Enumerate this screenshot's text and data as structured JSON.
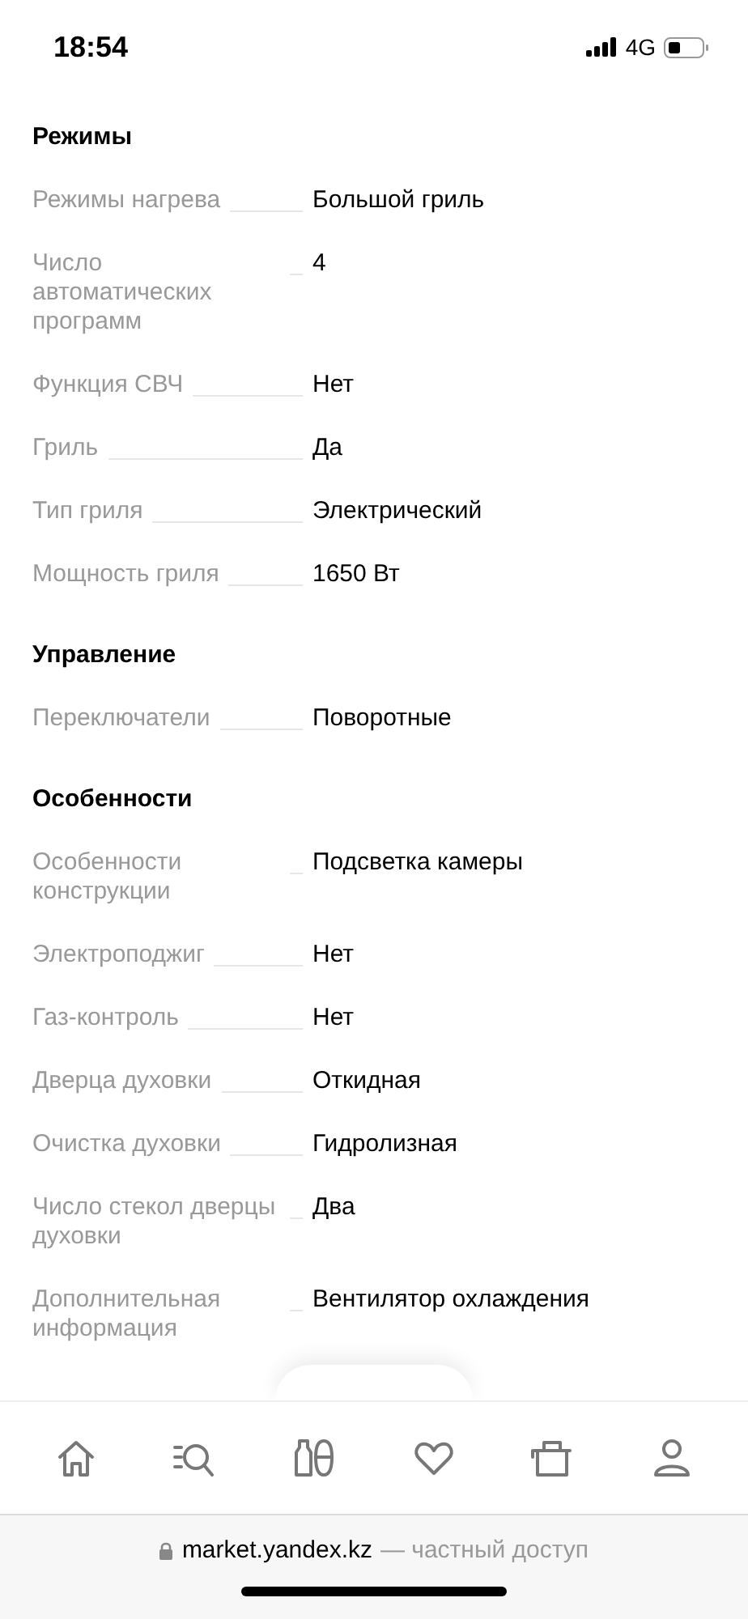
{
  "status_bar": {
    "time": "18:54",
    "network": "4G"
  },
  "sections": [
    {
      "title": "Режимы",
      "rows": [
        {
          "label": "Режимы нагрева",
          "value": "Большой гриль"
        },
        {
          "label": "Число автоматических программ",
          "value": "4"
        },
        {
          "label": "Функция СВЧ",
          "value": "Нет"
        },
        {
          "label": "Гриль",
          "value": "Да"
        },
        {
          "label": "Тип гриля",
          "value": "Электрический"
        },
        {
          "label": "Мощность гриля",
          "value": "1650 Вт"
        }
      ]
    },
    {
      "title": "Управление",
      "rows": [
        {
          "label": "Переключатели",
          "value": "Поворотные"
        }
      ]
    },
    {
      "title": "Особенности",
      "rows": [
        {
          "label": "Особенности конструкции",
          "value": "Подсветка камеры"
        },
        {
          "label": "Электроподжиг",
          "value": "Нет"
        },
        {
          "label": "Газ-контроль",
          "value": "Нет"
        },
        {
          "label": "Дверца духовки",
          "value": "Откидная"
        },
        {
          "label": "Очистка духовки",
          "value": "Гидролизная"
        },
        {
          "label": "Число стекол дверцы духовки",
          "value": "Два"
        },
        {
          "label": "Дополнительная информация",
          "value": "Вентилятор охлаждения"
        }
      ]
    }
  ],
  "bottom_nav": [
    {
      "kind": "home"
    },
    {
      "kind": "catalog"
    },
    {
      "kind": "products"
    },
    {
      "kind": "favorites"
    },
    {
      "kind": "cart"
    },
    {
      "kind": "profile"
    }
  ],
  "url_bar": {
    "domain": "market.yandex.kz",
    "note": "— частный доступ"
  }
}
